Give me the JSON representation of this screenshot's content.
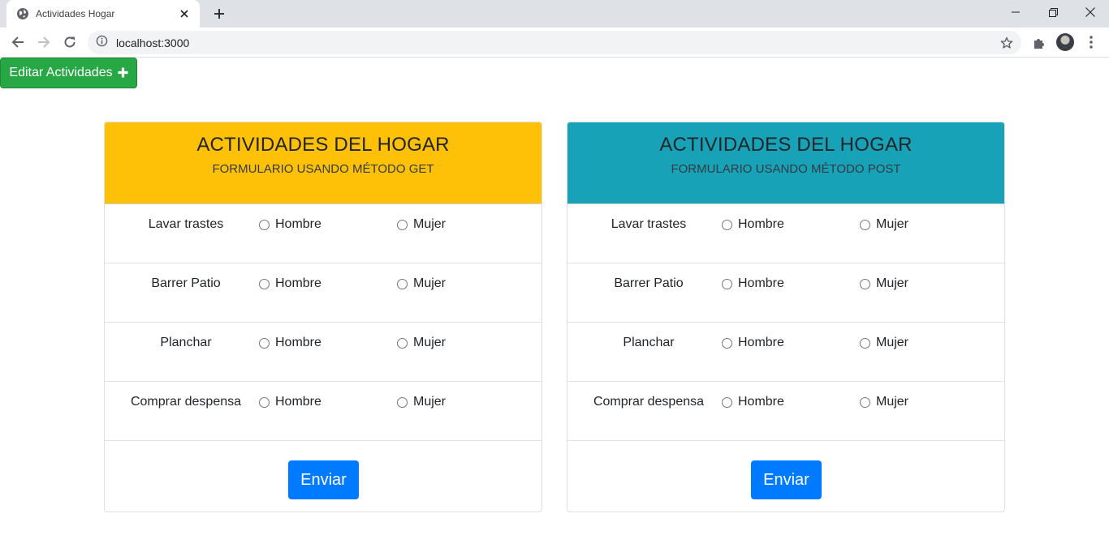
{
  "browser": {
    "tab_title": "Actividades Hogar",
    "url": "localhost:3000"
  },
  "edit_button": {
    "label": "Editar Actividades",
    "icon": "plus-icon"
  },
  "colors": {
    "get_header": "#ffc107",
    "post_header": "#17a2b8",
    "edit_button": "#28a745",
    "send_button": "#007bff"
  },
  "forms": [
    {
      "title": "ACTIVIDADES DEL HOGAR",
      "subtitle": "FORMULARIO USANDO MÉTODO GET",
      "activities": [
        {
          "name": "Lavar trastes",
          "option_man": "Hombre",
          "option_woman": "Mujer"
        },
        {
          "name": "Barrer Patio",
          "option_man": "Hombre",
          "option_woman": "Mujer"
        },
        {
          "name": "Planchar",
          "option_man": "Hombre",
          "option_woman": "Mujer"
        },
        {
          "name": "Comprar despensa",
          "option_man": "Hombre",
          "option_woman": "Mujer"
        }
      ],
      "submit_label": "Enviar"
    },
    {
      "title": "ACTIVIDADES DEL HOGAR",
      "subtitle": "FORMULARIO USANDO MÉTODO POST",
      "activities": [
        {
          "name": "Lavar trastes",
          "option_man": "Hombre",
          "option_woman": "Mujer"
        },
        {
          "name": "Barrer Patio",
          "option_man": "Hombre",
          "option_woman": "Mujer"
        },
        {
          "name": "Planchar",
          "option_man": "Hombre",
          "option_woman": "Mujer"
        },
        {
          "name": "Comprar despensa",
          "option_man": "Hombre",
          "option_woman": "Mujer"
        }
      ],
      "submit_label": "Enviar"
    }
  ]
}
